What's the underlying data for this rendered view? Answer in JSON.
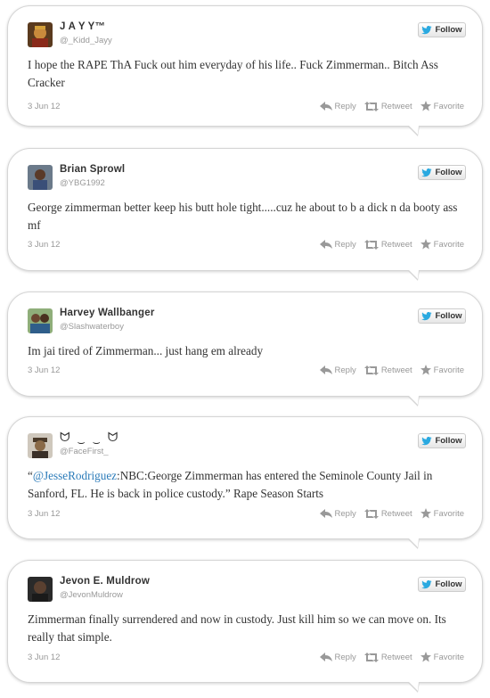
{
  "follow_label": "Follow",
  "actions": {
    "reply": "Reply",
    "retweet": "Retweet",
    "favorite": "Favorite"
  },
  "colors": {
    "bird_blue": "#2aa9e0",
    "mention_blue": "#2b7bb9",
    "text": "#333333",
    "muted": "#999999"
  },
  "tweets": [
    {
      "name": "J A Y Y™",
      "handle": "@_Kidd_Jayy",
      "text": "I hope the RAPE ThA Fuck out him everyday of his life.. Fuck Zimmerman.. Bitch Ass Cracker",
      "date": "3 Jun 12"
    },
    {
      "name": "Brian Sprowl",
      "handle": "@YBG1992",
      "text": "George zimmerman better keep his butt hole tight.....cuz he about to b a dick n da booty ass mf",
      "date": "3 Jun 12"
    },
    {
      "name": "Harvey Wallbanger",
      "handle": "@Slashwaterboy",
      "text": "Im jai tired of Zimmerman... just hang em already",
      "date": "3 Jun 12"
    },
    {
      "name": "ᗢ ‿ ‿ ᗢ",
      "handle": "@FaceFirst_",
      "text_prefix": "“",
      "text_mention": "@JesseRodriguez",
      "text_rest": ":NBC:George Zimmerman has entered the Seminole County Jail in Sanford, FL. He is back in police custody.” Rape Season Starts",
      "date": "3 Jun 12"
    },
    {
      "name": "Jevon E. Muldrow",
      "handle": "@JevonMuldrow",
      "text": "Zimmerman finally surrendered and now in custody. Just kill him so we can move on. Its really that simple.",
      "date": "3 Jun 12"
    }
  ]
}
